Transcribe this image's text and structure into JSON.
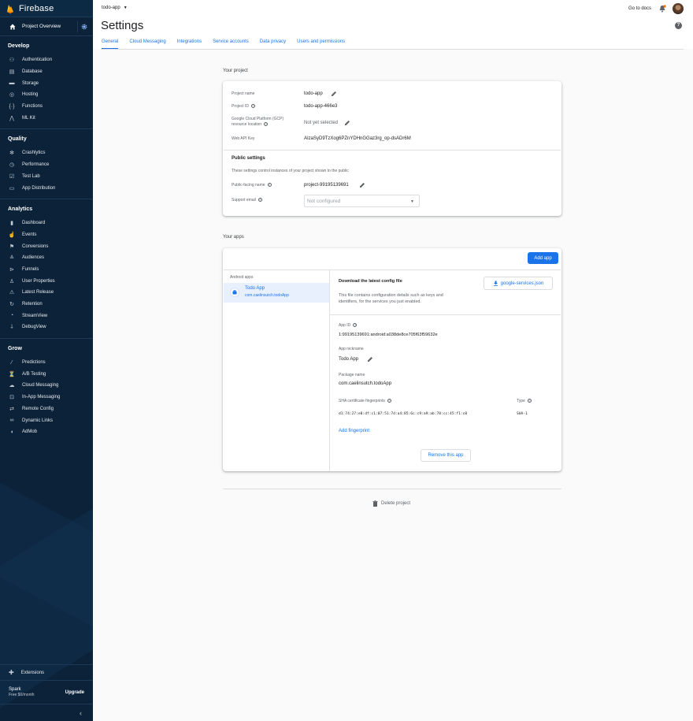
{
  "brand": "Firebase",
  "sidebar": {
    "overview": "Project Overview",
    "sections": [
      {
        "title": "Develop",
        "items": [
          {
            "label": "Authentication",
            "icon": "people-icon"
          },
          {
            "label": "Database",
            "icon": "database-icon"
          },
          {
            "label": "Storage",
            "icon": "storage-icon"
          },
          {
            "label": "Hosting",
            "icon": "hosting-icon"
          },
          {
            "label": "Functions",
            "icon": "functions-icon"
          },
          {
            "label": "ML Kit",
            "icon": "ml-kit-icon"
          }
        ]
      },
      {
        "title": "Quality",
        "items": [
          {
            "label": "Crashlytics",
            "icon": "crashlytics-icon"
          },
          {
            "label": "Performance",
            "icon": "performance-icon"
          },
          {
            "label": "Test Lab",
            "icon": "test-lab-icon"
          },
          {
            "label": "App Distribution",
            "icon": "app-distribution-icon"
          }
        ]
      },
      {
        "title": "Analytics",
        "items": [
          {
            "label": "Dashboard",
            "icon": "dashboard-icon"
          },
          {
            "label": "Events",
            "icon": "events-icon"
          },
          {
            "label": "Conversions",
            "icon": "flag-icon"
          },
          {
            "label": "Audiences",
            "icon": "audiences-icon"
          },
          {
            "label": "Funnels",
            "icon": "funnels-icon"
          },
          {
            "label": "User Properties",
            "icon": "user-properties-icon"
          },
          {
            "label": "Latest Release",
            "icon": "latest-release-icon"
          },
          {
            "label": "Retention",
            "icon": "retention-icon"
          },
          {
            "label": "StreamView",
            "icon": "streamview-icon"
          },
          {
            "label": "DebugView",
            "icon": "debugview-icon"
          }
        ]
      },
      {
        "title": "Grow",
        "items": [
          {
            "label": "Predictions",
            "icon": "predictions-icon"
          },
          {
            "label": "A/B Testing",
            "icon": "ab-testing-icon"
          },
          {
            "label": "Cloud Messaging",
            "icon": "cloud-messaging-icon"
          },
          {
            "label": "In-App Messaging",
            "icon": "in-app-messaging-icon"
          },
          {
            "label": "Remote Config",
            "icon": "remote-config-icon"
          },
          {
            "label": "Dynamic Links",
            "icon": "dynamic-links-icon"
          },
          {
            "label": "AdMob",
            "icon": "admob-icon"
          }
        ]
      }
    ],
    "extensions": "Extensions",
    "plan": {
      "name": "Spark",
      "price": "Free $0/month",
      "upgrade": "Upgrade"
    },
    "collapse": "‹"
  },
  "header": {
    "project": "todo-app",
    "title": "Settings",
    "docs": "Go to docs",
    "help": "?",
    "tabs": [
      "General",
      "Cloud Messaging",
      "Integrations",
      "Service accounts",
      "Data privacy",
      "Users and permissions"
    ]
  },
  "your_project": {
    "heading": "Your project",
    "project_name_label": "Project name",
    "project_name": "todo-app",
    "project_id_label": "Project ID",
    "project_id": "todo-app-466e3",
    "gcp_label_1": "Google Cloud Platform (GCP)",
    "gcp_label_2": "resource location",
    "gcp_value": "Not yet selected",
    "api_key_label": "Web API Key",
    "api_key": "AIzaSyD9TzXog6PZnYDHnGGaz3rg_op-dsADr6M",
    "public_heading": "Public settings",
    "public_desc": "These settings control instances of your project shown to the public",
    "public_name_label": "Public-facing name",
    "public_name": "project-99195139691",
    "support_email_label": "Support email",
    "support_email_placeholder": "Not configured"
  },
  "your_apps": {
    "heading": "Your apps",
    "add_app": "Add app",
    "android_label": "Android apps",
    "app_name": "Todo App",
    "app_package": "com.caelinsutch.todoApp",
    "config_title": "Download the latest config file",
    "config_desc_1": "This file contains configuration details such as keys and",
    "config_desc_2": "identifiers, for the services you just enabled.",
    "config_button": "google-services.json",
    "app_id_label": "App ID",
    "app_id": "1:99195139691:android:a038de8ce705f63f59632e",
    "nickname_label": "App nickname",
    "nickname": "Todo App",
    "package_label": "Package name",
    "package": "com.caelinsutch.todoApp",
    "sha_label": "SHA certificate fingerprints",
    "type_label": "Type",
    "sha_value": "d1:74:27:e8:df:c1:07:51:7d:a4:85:6c:c9:a9:ab:78:cc:45:f1:c0",
    "sha_type": "SHA-1",
    "add_fingerprint": "Add fingerprint",
    "remove_app": "Remove this app"
  },
  "delete_project": "Delete project",
  "colors": {
    "sidebar": "#0b2239",
    "accent": "#1a73e8",
    "background": "#fafafa"
  }
}
